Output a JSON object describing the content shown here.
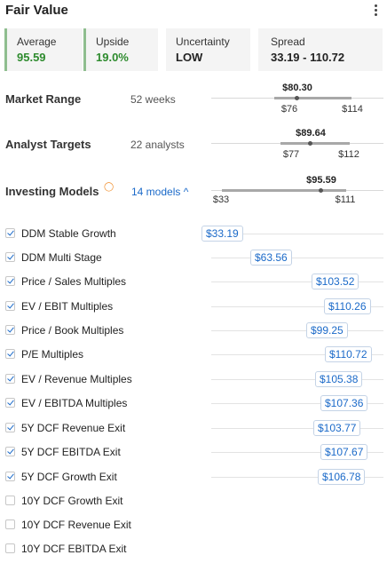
{
  "header": {
    "title": "Fair Value",
    "menu_icon": "kebab-vertical-icon"
  },
  "metrics": [
    {
      "label": "Average",
      "value": "95.59",
      "color": "#2e8b2e"
    },
    {
      "label": "Upside",
      "value": "19.0%",
      "color": "#2e8b2e"
    },
    {
      "label": "Uncertainty",
      "value": "LOW",
      "color": "#222222"
    },
    {
      "label": "Spread",
      "value": "33.19 - 110.72",
      "color": "#222222"
    }
  ],
  "ranges": {
    "market": {
      "label": "Market Range",
      "sub": "52 weeks",
      "current": "$80.30",
      "low": "$76",
      "high": "$114"
    },
    "analyst": {
      "label": "Analyst Targets",
      "sub": "22 analysts",
      "current": "$89.64",
      "low": "$77",
      "high": "$112"
    },
    "models": {
      "label": "Investing Models",
      "sub": "14 models ^",
      "current": "$95.59",
      "low": "$33",
      "high": "$111",
      "info_icon": "info-icon"
    }
  },
  "models": [
    {
      "name": "DDM Stable Growth",
      "value": "$33.19",
      "checked": true
    },
    {
      "name": "DDM Multi Stage",
      "value": "$63.56",
      "checked": true
    },
    {
      "name": "Price / Sales Multiples",
      "value": "$103.52",
      "checked": true
    },
    {
      "name": "EV / EBIT Multiples",
      "value": "$110.26",
      "checked": true
    },
    {
      "name": "Price / Book Multiples",
      "value": "$99.25",
      "checked": true
    },
    {
      "name": "P/E Multiples",
      "value": "$110.72",
      "checked": true
    },
    {
      "name": "EV / Revenue Multiples",
      "value": "$105.38",
      "checked": true
    },
    {
      "name": "EV / EBITDA Multiples",
      "value": "$107.36",
      "checked": true
    },
    {
      "name": "5Y DCF Revenue Exit",
      "value": "$103.77",
      "checked": true
    },
    {
      "name": "5Y DCF EBITDA Exit",
      "value": "$107.67",
      "checked": true
    },
    {
      "name": "5Y DCF Growth Exit",
      "value": "$106.78",
      "checked": true
    },
    {
      "name": "10Y DCF Growth Exit",
      "value": "",
      "checked": false
    },
    {
      "name": "10Y DCF Revenue Exit",
      "value": "",
      "checked": false
    },
    {
      "name": "10Y DCF EBITDA Exit",
      "value": "",
      "checked": false
    }
  ]
}
